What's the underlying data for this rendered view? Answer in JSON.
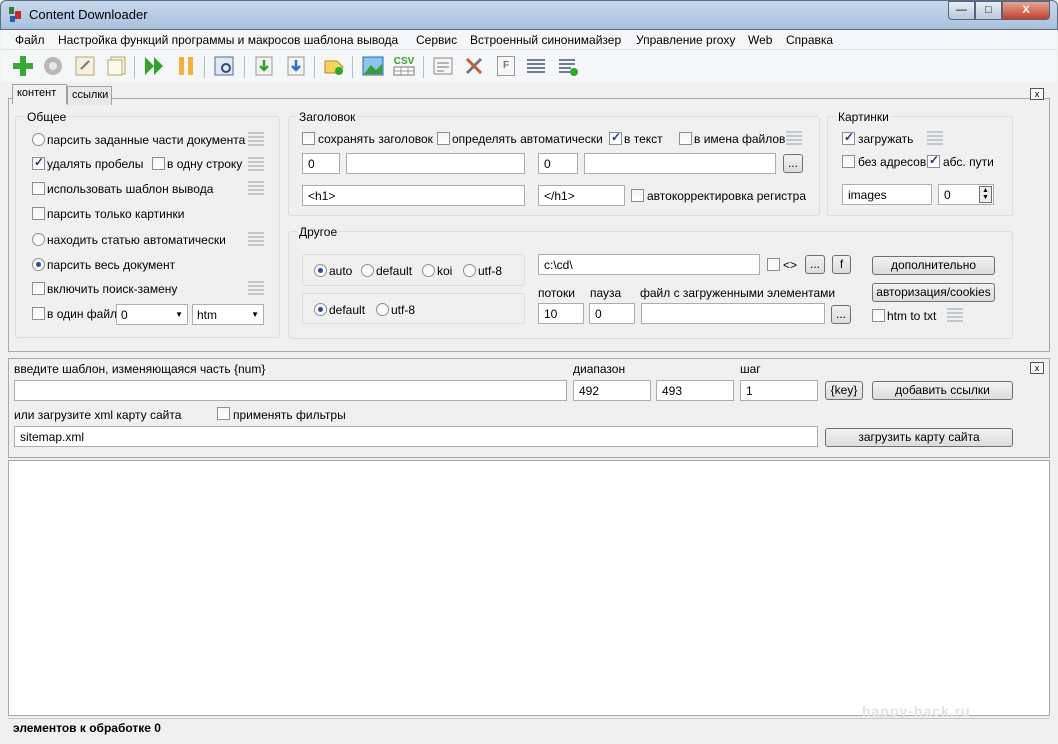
{
  "window": {
    "title": "Content Downloader",
    "min": "—",
    "max": "□",
    "close": "X"
  },
  "menu": [
    "Файл",
    "Настройка функций программы и макросов шаблона вывода",
    "Сервис",
    "Встроенный синонимайзер",
    "Управление proxy",
    "Web",
    "Справка"
  ],
  "toolbar": {
    "csv_label": "CSV",
    "f_label": "F"
  },
  "tabs": {
    "content": "контент",
    "links": "ссылки"
  },
  "close_label": "x",
  "general": {
    "title": "Общее",
    "parse_parts": "парсить заданные части документа",
    "remove_spaces": "удалять пробелы",
    "one_line": "в одну строку",
    "use_template": "использовать шаблон вывода",
    "only_images": "парсить только картинки",
    "find_article": "находить статью автоматически",
    "parse_whole": "парсить весь документ",
    "search_replace": "включить поиск-замену",
    "one_file": "в один файл",
    "file_select": "0",
    "ext_select": "htm"
  },
  "heading": {
    "title": "Заголовок",
    "save": "сохранять заголовок",
    "auto": "определять автоматически",
    "to_text": "в текст",
    "to_filenames": "в имена файлов",
    "v1": "0",
    "v2": "",
    "v3": "0",
    "v4": "",
    "ellipsis": "...",
    "start_tag": "<h1>",
    "end_tag": "</h1>",
    "autocorrect": "автокорректировка регистра"
  },
  "images": {
    "title": "Картинки",
    "download": "загружать",
    "no_addresses": "без адресов",
    "abs_paths": "абс. пути",
    "folder": "images",
    "spin_value": "0"
  },
  "other": {
    "title": "Другое",
    "enc1": [
      "auto",
      "default",
      "koi",
      "utf-8"
    ],
    "enc2": [
      "default",
      "utf-8"
    ],
    "path": "c:\\cd\\",
    "tags": "<>",
    "ellipsis": "...",
    "f": "f",
    "more": "дополнительно",
    "auth": "авторизация/cookies",
    "threads_label": "потоки",
    "threads": "10",
    "pause_label": "пауза",
    "pause": "0",
    "file_label": "файл с загруженными элементами",
    "file_value": "",
    "htm_to_txt": "htm to txt"
  },
  "links": {
    "template_label": "введите шаблон, изменяющаяся часть {num}",
    "template_value": "",
    "range_label": "диапазон",
    "range_from": "492",
    "range_to": "493",
    "step_label": "шаг",
    "step": "1",
    "key": "{key}",
    "add": "добавить ссылки",
    "xml_label": "или загрузите xml карту сайта",
    "apply_filters": "применять фильтры",
    "sitemap": "sitemap.xml",
    "load_map": "загрузить карту сайта"
  },
  "status": {
    "text": "элементов к обработке 0"
  },
  "watermark": "happy-hack.ru"
}
